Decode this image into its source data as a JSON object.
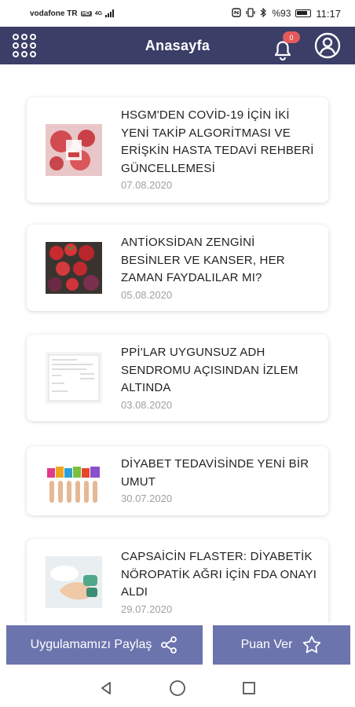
{
  "status_bar": {
    "carrier": "vodafone TR",
    "network_badge": "HD",
    "network_type": "4G",
    "battery": "%93",
    "time": "11:17"
  },
  "header": {
    "title": "Anasayfa",
    "notification_count": "0"
  },
  "news": [
    {
      "title": "HSGM'DEN COVİD-19 İÇİN İKİ YENİ TAKİP ALGORİTMASI VE ERİŞKİN HASTA TEDAVİ REHBERİ GÜNCELLEMESİ",
      "date": "07.08.2020",
      "thumb": "covid-virus-image"
    },
    {
      "title": "ANTİOKSİDAN ZENGİNİ BESİNLER VE KANSER, HER ZAMAN FAYDALILAR MI?",
      "date": "05.08.2020",
      "thumb": "strawberries-image"
    },
    {
      "title": "PPİ'LAR UYGUNSUZ ADH SENDROMU AÇISINDAN İZLEM ALTINDA",
      "date": "03.08.2020",
      "thumb": "document-image"
    },
    {
      "title": "DİYABET TEDAVİSİNDE YENİ BİR UMUT",
      "date": "30.07.2020",
      "thumb": "diabetes-hands-image"
    },
    {
      "title": "CAPSAİCİN  FLASTER: DİYABETİK NÖROPATİK AĞRI İÇİN FDA ONAYI ALDI",
      "date": "29.07.2020",
      "thumb": "foot-care-image"
    }
  ],
  "actions": {
    "share_label": "Uygulamamızı Paylaş",
    "rate_label": "Puan Ver"
  },
  "colors": {
    "header_bg": "#3b3e67",
    "button_bg": "#6c74ae",
    "badge_bg": "#e35a5a",
    "date_text": "#a0a0a0"
  }
}
